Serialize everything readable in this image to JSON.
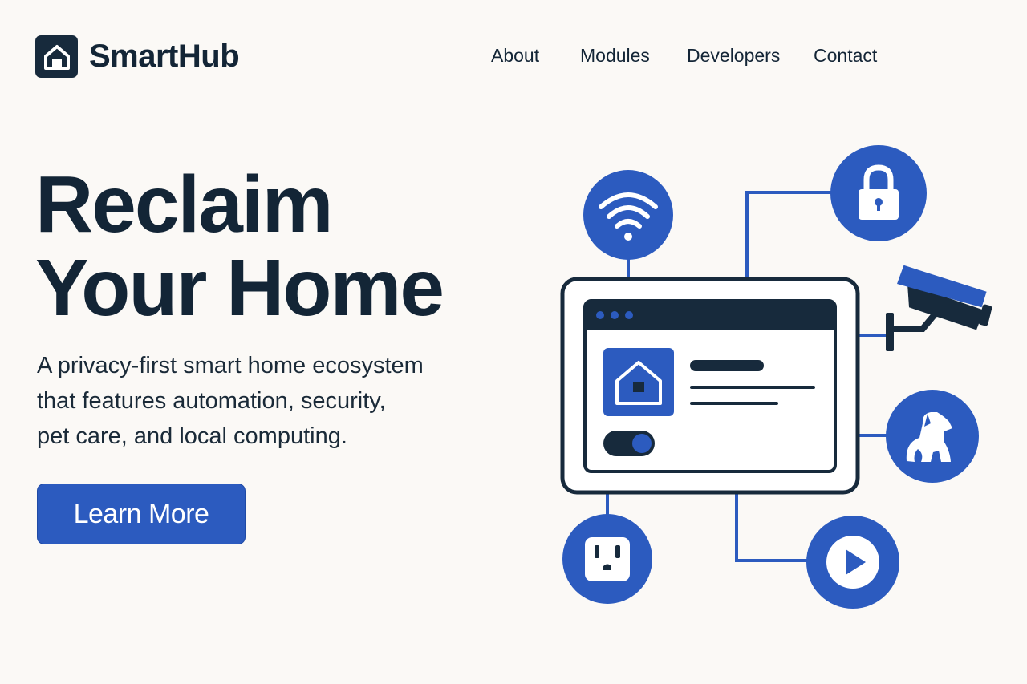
{
  "brand": {
    "name": "SmartHub",
    "logo_icon": "home-icon"
  },
  "nav": {
    "items": [
      {
        "label": "About"
      },
      {
        "label": "Modules"
      },
      {
        "label": "Developers"
      },
      {
        "label": "Contact"
      }
    ]
  },
  "hero": {
    "headline_line1": "Reclaim",
    "headline_line2": "Your Home",
    "subtitle_line1": "A privacy-first smart home ecosystem",
    "subtitle_line2": "that features automation, security,",
    "subtitle_line3": "pet care, and local computing.",
    "cta_label": "Learn More"
  },
  "illustration": {
    "icons": [
      "wifi-icon",
      "lock-icon",
      "security-camera-icon",
      "dog-icon",
      "power-outlet-icon",
      "play-icon",
      "home-icon",
      "toggle-switch-icon"
    ]
  },
  "colors": {
    "background": "#fbf9f6",
    "text": "#132536",
    "accent": "#2c5bbf",
    "dark": "#172a3c"
  }
}
